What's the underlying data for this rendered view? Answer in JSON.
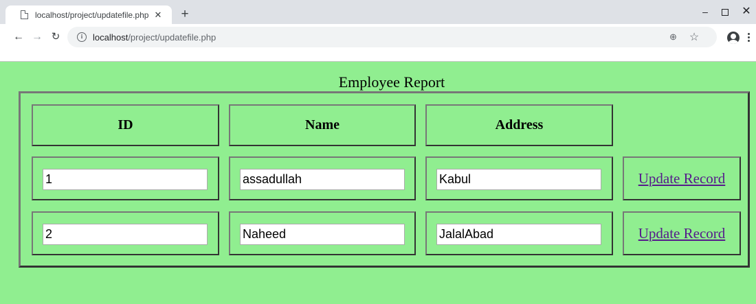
{
  "browser": {
    "tab_title": "localhost/project/updatefile.php",
    "tab_close_glyph": "✕",
    "new_tab_glyph": "+",
    "url_host": "localhost",
    "url_path": "/project/updatefile.php",
    "icons": [
      "document-icon",
      "close-icon",
      "plus-icon",
      "back-arrow-icon",
      "forward-arrow-icon",
      "reload-icon",
      "info-icon",
      "zoom-icon",
      "star-icon",
      "account-icon",
      "menu-icon"
    ]
  },
  "window": {
    "minimize_glyph": "–",
    "close_glyph": "✕"
  },
  "page": {
    "title": "Employee Report",
    "background_color": "#90ee90",
    "link_color": "#551a8b",
    "headers": {
      "id": "ID",
      "name": "Name",
      "address": "Address"
    },
    "rows": [
      {
        "id": "1",
        "name": "assadullah",
        "address": "Kabul",
        "action": "Update Record"
      },
      {
        "id": "2",
        "name": "Naheed",
        "address": "JalalAbad",
        "action": "Update Record"
      }
    ]
  }
}
